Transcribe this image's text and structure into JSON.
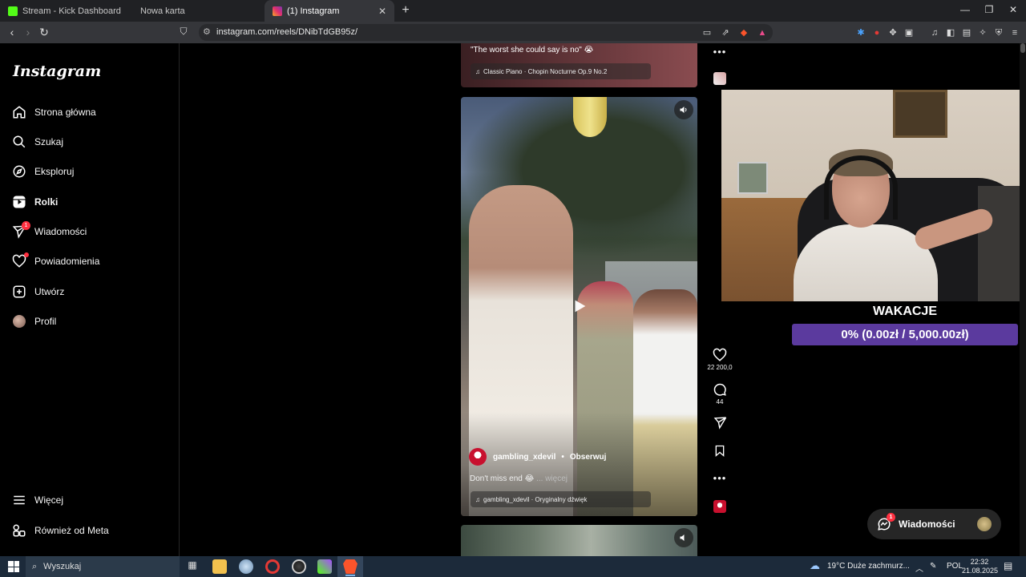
{
  "browser": {
    "tabs": [
      {
        "label": "Stream - Kick Dashboard",
        "active": false,
        "icon": "kick-icon"
      },
      {
        "label": "Nowa karta",
        "active": false,
        "icon": ""
      },
      {
        "label": "(1) Instagram",
        "active": true,
        "icon": "instagram-icon"
      }
    ],
    "url": "instagram.com/reels/DNibTdGB95z/"
  },
  "sidebar": {
    "logo": "Instagram",
    "items": [
      {
        "label": "Strona główna",
        "icon": "home-icon"
      },
      {
        "label": "Szukaj",
        "icon": "search-icon"
      },
      {
        "label": "Eksploruj",
        "icon": "compass-icon"
      },
      {
        "label": "Rolki",
        "icon": "reels-icon",
        "active": true
      },
      {
        "label": "Wiadomości",
        "icon": "messages-icon",
        "badge": "1"
      },
      {
        "label": "Powiadomienia",
        "icon": "heart-icon",
        "dot": true
      },
      {
        "label": "Utwórz",
        "icon": "create-icon"
      },
      {
        "label": "Profil",
        "icon": "profile-avatar"
      }
    ],
    "bottom": [
      {
        "label": "Więcej",
        "icon": "menu-icon"
      },
      {
        "label": "Również od Meta",
        "icon": "meta-icon"
      }
    ]
  },
  "feed": {
    "previous_reel": {
      "caption": "\"The worst she could say is no\" 😭",
      "audio": "Classic Piano · Chopin Nocturne Op.9 No.2"
    },
    "current_reel": {
      "author": "gambling_xdevil",
      "follow_label": "Obserwuj",
      "separator": "•",
      "caption": "Don't miss end 😂",
      "more_label": "... więcej",
      "audio": "gambling_xdevil · Oryginalny dźwięk",
      "likes": "22 200,0",
      "comments": "44"
    }
  },
  "stream_overlay": {
    "goal_title": "WAKACJE",
    "goal_progress": "0% (0.00zł / 5,000.00zł)",
    "goal_fraction": 0
  },
  "messages_pill": {
    "label": "Wiadomości",
    "badge": "1"
  },
  "taskbar": {
    "search_placeholder": "Wyszukaj",
    "weather": "19°C  Duże zachmurz...",
    "language": "POL",
    "time": "22:32",
    "date": "21.08.2025"
  },
  "colors": {
    "accent_purple": "#5b3a9e",
    "ig_red": "#ff3040",
    "kick_green": "#53fc18"
  }
}
